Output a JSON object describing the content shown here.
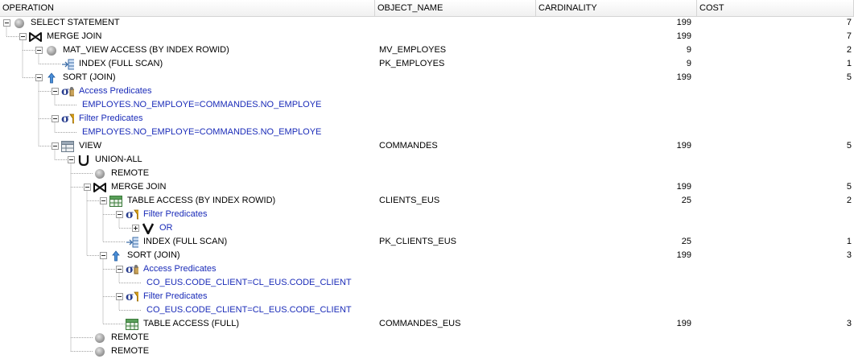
{
  "columns": [
    {
      "key": "operation",
      "label": "OPERATION"
    },
    {
      "key": "object_name",
      "label": "OBJECT_NAME"
    },
    {
      "key": "cardinality",
      "label": "CARDINALITY"
    },
    {
      "key": "cost",
      "label": "COST"
    }
  ],
  "rows": [
    {
      "depth": 0,
      "toggle": "minus",
      "icon": "circle-icon",
      "label": "SELECT STATEMENT",
      "object": "",
      "cardinality": "199",
      "cost": "7"
    },
    {
      "depth": 1,
      "toggle": "minus",
      "icon": "merge-join-icon",
      "label": "MERGE JOIN",
      "object": "",
      "cardinality": "199",
      "cost": "7"
    },
    {
      "depth": 2,
      "toggle": "minus",
      "icon": "circle-icon",
      "label": "MAT_VIEW ACCESS (BY INDEX ROWID)",
      "object": "MV_EMPLOYES",
      "cardinality": "9",
      "cost": "2"
    },
    {
      "depth": 3,
      "toggle": "none",
      "icon": "index-icon",
      "label": "INDEX (FULL SCAN)",
      "object": "PK_EMPLOYES",
      "cardinality": "9",
      "cost": "1"
    },
    {
      "depth": 2,
      "toggle": "minus",
      "icon": "sort-icon",
      "label": "SORT (JOIN)",
      "object": "",
      "cardinality": "199",
      "cost": "5"
    },
    {
      "depth": 3,
      "toggle": "minus",
      "icon": "access-predicate-icon",
      "label": "Access Predicates",
      "object": "",
      "cardinality": "",
      "cost": "",
      "kind": "pred-head"
    },
    {
      "depth": 4,
      "toggle": "none",
      "icon": "",
      "label": "EMPLOYES.NO_EMPLOYE=COMMANDES.NO_EMPLOYE",
      "object": "",
      "cardinality": "",
      "cost": "",
      "kind": "pred-text"
    },
    {
      "depth": 3,
      "toggle": "minus",
      "icon": "filter-predicate-icon",
      "label": "Filter Predicates",
      "object": "",
      "cardinality": "",
      "cost": "",
      "kind": "pred-head"
    },
    {
      "depth": 4,
      "toggle": "none",
      "icon": "",
      "label": "EMPLOYES.NO_EMPLOYE=COMMANDES.NO_EMPLOYE",
      "object": "",
      "cardinality": "",
      "cost": "",
      "kind": "pred-text"
    },
    {
      "depth": 3,
      "toggle": "minus",
      "icon": "view-icon",
      "label": "VIEW",
      "object": "COMMANDES",
      "cardinality": "199",
      "cost": "5"
    },
    {
      "depth": 4,
      "toggle": "minus",
      "icon": "union-icon",
      "label": "UNION-ALL",
      "object": "",
      "cardinality": "",
      "cost": ""
    },
    {
      "depth": 5,
      "toggle": "none",
      "icon": "circle-icon",
      "label": "REMOTE",
      "object": "",
      "cardinality": "",
      "cost": ""
    },
    {
      "depth": 5,
      "toggle": "minus",
      "icon": "merge-join-icon",
      "label": "MERGE JOIN",
      "object": "",
      "cardinality": "199",
      "cost": "5"
    },
    {
      "depth": 6,
      "toggle": "minus",
      "icon": "table-icon",
      "label": "TABLE ACCESS (BY INDEX ROWID)",
      "object": "CLIENTS_EUS",
      "cardinality": "25",
      "cost": "2"
    },
    {
      "depth": 7,
      "toggle": "minus",
      "icon": "filter-predicate-icon",
      "label": "Filter Predicates",
      "object": "",
      "cardinality": "",
      "cost": "",
      "kind": "pred-head"
    },
    {
      "depth": 8,
      "toggle": "plus",
      "icon": "or-icon",
      "label": "OR",
      "object": "",
      "cardinality": "",
      "cost": "",
      "kind": "pred-head"
    },
    {
      "depth": 7,
      "toggle": "none",
      "icon": "index-icon",
      "label": "INDEX (FULL SCAN)",
      "object": "PK_CLIENTS_EUS",
      "cardinality": "25",
      "cost": "1"
    },
    {
      "depth": 6,
      "toggle": "minus",
      "icon": "sort-icon",
      "label": "SORT (JOIN)",
      "object": "",
      "cardinality": "199",
      "cost": "3"
    },
    {
      "depth": 7,
      "toggle": "minus",
      "icon": "access-predicate-icon",
      "label": "Access Predicates",
      "object": "",
      "cardinality": "",
      "cost": "",
      "kind": "pred-head"
    },
    {
      "depth": 8,
      "toggle": "none",
      "icon": "",
      "label": "CO_EUS.CODE_CLIENT=CL_EUS.CODE_CLIENT",
      "object": "",
      "cardinality": "",
      "cost": "",
      "kind": "pred-text"
    },
    {
      "depth": 7,
      "toggle": "minus",
      "icon": "filter-predicate-icon",
      "label": "Filter Predicates",
      "object": "",
      "cardinality": "",
      "cost": "",
      "kind": "pred-head"
    },
    {
      "depth": 8,
      "toggle": "none",
      "icon": "",
      "label": "CO_EUS.CODE_CLIENT=CL_EUS.CODE_CLIENT",
      "object": "",
      "cardinality": "",
      "cost": "",
      "kind": "pred-text"
    },
    {
      "depth": 7,
      "toggle": "none",
      "icon": "table-icon",
      "label": "TABLE ACCESS (FULL)",
      "object": "COMMANDES_EUS",
      "cardinality": "199",
      "cost": "3"
    },
    {
      "depth": 5,
      "toggle": "none",
      "icon": "circle-icon",
      "label": "REMOTE",
      "object": "",
      "cardinality": "",
      "cost": ""
    },
    {
      "depth": 5,
      "toggle": "none",
      "icon": "circle-icon",
      "label": "REMOTE",
      "object": "",
      "cardinality": "",
      "cost": ""
    }
  ]
}
